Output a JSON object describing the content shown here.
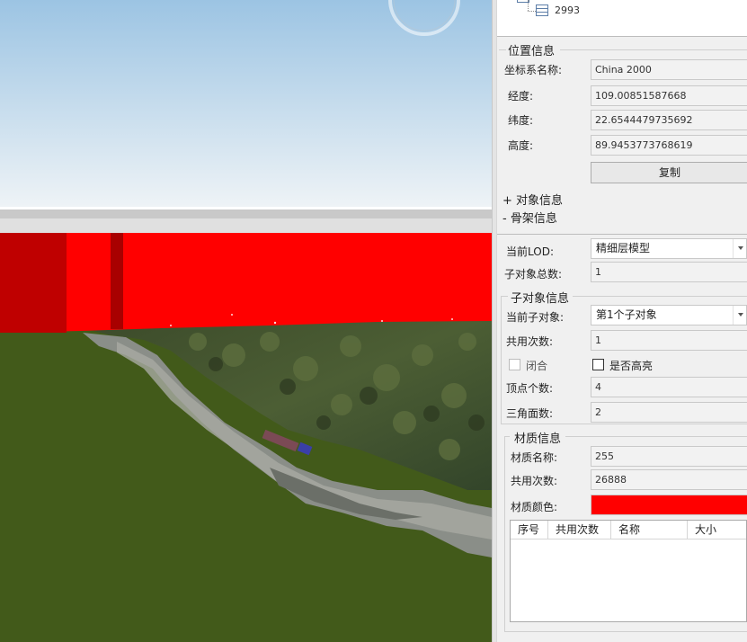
{
  "tree": {
    "node_label": "2993"
  },
  "position": {
    "title": "位置信息",
    "crs_label": "坐标系名称:",
    "crs_value": "China 2000",
    "lon_label": "经度:",
    "lon_value": "109.00851587668",
    "lat_label": "纬度:",
    "lat_value": "22.6544479735692",
    "alt_label": "高度:",
    "alt_value": "89.9453773768619",
    "copy_button": "复制"
  },
  "sections": {
    "object_info": "+ 对象信息",
    "skeleton_info": "- 骨架信息"
  },
  "skeleton": {
    "lod_label": "当前LOD:",
    "lod_value": "精细层模型",
    "child_total_label": "子对象总数:",
    "child_total_value": "1"
  },
  "child": {
    "title": "子对象信息",
    "current_label": "当前子对象:",
    "current_value": "第1个子对象",
    "shared_label": "共用次数:",
    "shared_value": "1",
    "closed_label": "闭合",
    "highlight_label": "是否高亮",
    "vertex_label": "顶点个数:",
    "vertex_value": "4",
    "triangle_label": "三角面数:",
    "triangle_value": "2"
  },
  "material": {
    "title": "材质信息",
    "name_label": "材质名称:",
    "name_value": "255",
    "shared_label": "共用次数:",
    "shared_value": "26888",
    "color_label": "材质颜色:",
    "color_value": "#ff0000",
    "table_headers": [
      "序号",
      "共用次数",
      "名称",
      "大小"
    ]
  },
  "colors": {
    "sky_top": "#9cc4e3",
    "sky_bottom": "#eef3f6",
    "ground": "#425a1a",
    "highlight": "#ff0000"
  }
}
